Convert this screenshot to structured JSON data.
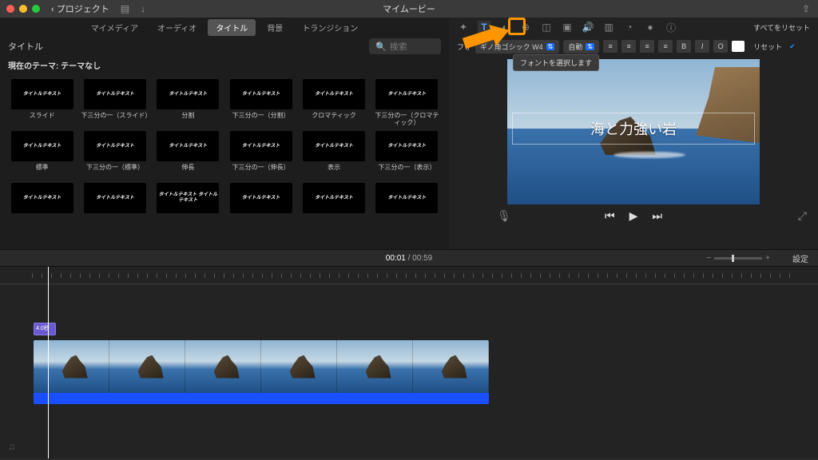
{
  "titlebar": {
    "back": "プロジェクト",
    "title": "マイムービー"
  },
  "browser": {
    "tabs": [
      "マイメディア",
      "オーディオ",
      "タイトル",
      "背景",
      "トランジション"
    ],
    "active": "タイトル",
    "section": "タイトル",
    "search_placeholder": "検索",
    "theme": "現在のテーマ: テーマなし",
    "titles": [
      {
        "thumb": "タイトルテキスト",
        "label": "スライド"
      },
      {
        "thumb": "タイトルテキスト",
        "label": "下三分の一（スライド）"
      },
      {
        "thumb": "タイトルテキスト",
        "label": "分割"
      },
      {
        "thumb": "タイトルテキスト",
        "label": "下三分の一（分割）"
      },
      {
        "thumb": "タイトルテキスト",
        "label": "クロマティック"
      },
      {
        "thumb": "タイトルテキスト",
        "label": "下三分の一（クロマティック）"
      },
      {
        "thumb": "タイトルテキスト",
        "label": "標準"
      },
      {
        "thumb": "タイトルテキスト",
        "label": "下三分の一（標準）"
      },
      {
        "thumb": "タイトルテキスト",
        "label": "伸長"
      },
      {
        "thumb": "タイトルテキスト",
        "label": "下三分の一（伸長）"
      },
      {
        "thumb": "タイトルテキスト",
        "label": "表示"
      },
      {
        "thumb": "タイトルテキスト",
        "label": "下三分の一（表示）"
      },
      {
        "thumb": "タイトルテキスト",
        "label": ""
      },
      {
        "thumb": "タイトルテキスト",
        "label": ""
      },
      {
        "thumb": "タイトルテキスト\nタイトルテキスト",
        "label": ""
      },
      {
        "thumb": "タイトルテキスト",
        "label": ""
      },
      {
        "thumb": "タイトルテキスト",
        "label": ""
      },
      {
        "thumb": "タイトルテキスト",
        "label": ""
      }
    ]
  },
  "inspector": {
    "reset_all": "すべてをリセット",
    "font_label": "フォ",
    "font_name": "ギノ角ゴシック W4",
    "size_mode": "自動",
    "bold": "B",
    "italic": "I",
    "outline": "O",
    "reset": "リセット",
    "tooltip": "フォントを選択します"
  },
  "preview": {
    "title_text": "海と力強い岩"
  },
  "time": {
    "current": "00:01",
    "total": "00:59",
    "settings": "設定"
  },
  "timeline": {
    "title_clip": "4.0秒 –"
  }
}
